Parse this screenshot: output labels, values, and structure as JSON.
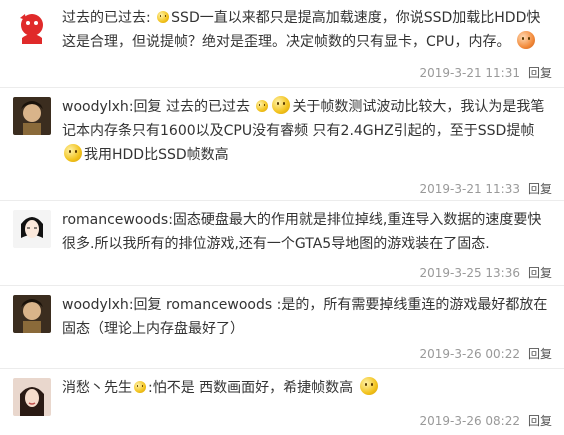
{
  "comments": [
    {
      "user": "过去的已过去",
      "reply_to": "",
      "text_before": "SSD一直以来都只是提高加载速度，你说SSD加载比HDD快这是合理，但说提帧？绝对是歪理。决定帧数的只有显卡，CPU，内存。",
      "text_after": "",
      "time": "2019-3-21 11:31",
      "reply_label": "回复"
    },
    {
      "user": "woodylxh",
      "reply_word": "回复",
      "reply_to": "过去的已过去",
      "text_before": "关于帧数测试波动比较大，我认为是我笔记本内存条只有1600以及CPU没有睿频 只有2.4GHZ引起的，至于SSD提帧",
      "text_after": "我用HDD比SSD帧数高",
      "time": "2019-3-21 11:33",
      "reply_label": "回复"
    },
    {
      "user": "romancewoods",
      "reply_to": "",
      "text_before": "固态硬盘最大的作用就是排位掉线,重连导入数据的速度要快很多.所以我所有的排位游戏,还有一个GTA5导地图的游戏装在了固态.",
      "text_after": "",
      "time": "2019-3-25 13:36",
      "reply_label": "回复"
    },
    {
      "user": "woodylxh",
      "reply_word": "回复",
      "reply_to": "romancewoods",
      "text_before": ":是的，所有需要掉线重连的游戏最好都放在固态（理论上内存盘最好了）",
      "text_after": "",
      "time": "2019-3-26 00:22",
      "reply_label": "回复"
    },
    {
      "user": "消愁丶先生",
      "reply_to": "",
      "text_before": ":怕不是 西数画面好，希捷帧数高",
      "text_after": "",
      "time": "2019-3-26 08:22",
      "reply_label": "回复"
    }
  ],
  "icons": {
    "c1_emoji": "pout-emoji",
    "c2_emoji": "smile-emoji",
    "c5_emoji": "smile-emoji"
  }
}
